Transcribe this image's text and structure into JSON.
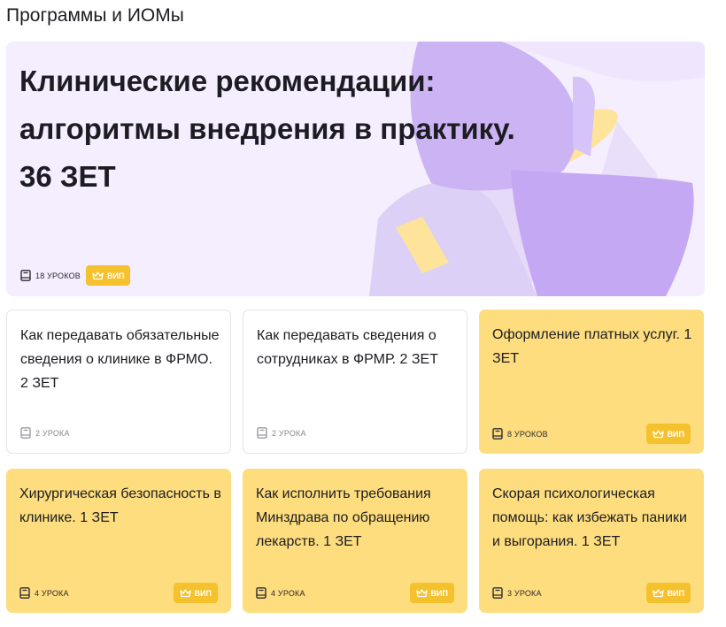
{
  "section": {
    "title": "Программы и ИОМы"
  },
  "hero": {
    "title_lines": [
      "Клинические рекомендации:",
      "алгоритмы внедрения в практику.",
      "36 ЗЕТ"
    ],
    "lessons": "18 уроков",
    "badge": "вип"
  },
  "cards": [
    {
      "title": "Как передавать обязательные сведения о клинике в ФРМО. 2 ЗЕТ",
      "lessons": "2 урока",
      "badge": null,
      "style": "white"
    },
    {
      "title": "Как передавать сведения о сотрудниках в ФРМР. 2 ЗЕТ",
      "lessons": "2 урока",
      "badge": null,
      "style": "white"
    },
    {
      "title": "Оформление платных услуг. 1 ЗЕТ",
      "lessons": "8 уроков",
      "badge": "вип",
      "style": "yellow"
    },
    {
      "title": "Хирургическая безопасность в клинике. 1 ЗЕТ",
      "lessons": "4 урока",
      "badge": "вип",
      "style": "yellow"
    },
    {
      "title": "Как исполнить требования Минздрава по обращению лекарств. 1 ЗЕТ",
      "lessons": "4 урока",
      "badge": "вип",
      "style": "yellow"
    },
    {
      "title": "Скорая психологическая помощь: как избежать паники и выгорания. 1 ЗЕТ",
      "lessons": "3 урока",
      "badge": "вип",
      "style": "yellow"
    }
  ],
  "icons": {
    "lessons": "book-icon",
    "badge": "crown-icon"
  },
  "colors": {
    "hero_bg": "#f4eefe",
    "card_yellow": "#fedd7e",
    "badge": "#f5c12c",
    "lavender": "#cbb3f4",
    "lavender_light": "#e6daf9",
    "pale_yellow": "#fde49a"
  }
}
